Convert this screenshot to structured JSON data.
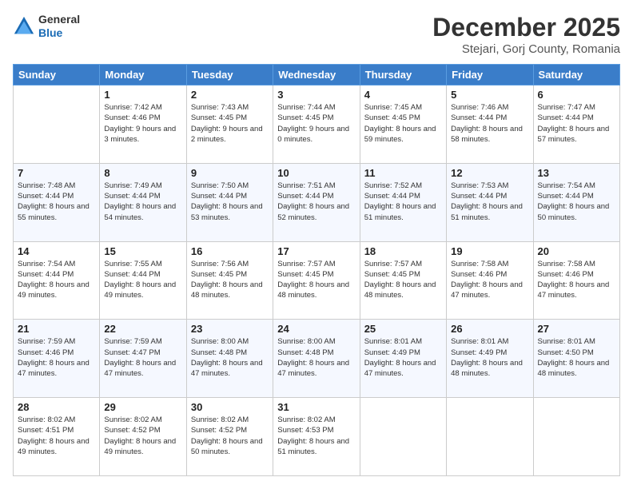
{
  "logo": {
    "general": "General",
    "blue": "Blue"
  },
  "header": {
    "month": "December 2025",
    "location": "Stejari, Gorj County, Romania"
  },
  "weekdays": [
    "Sunday",
    "Monday",
    "Tuesday",
    "Wednesday",
    "Thursday",
    "Friday",
    "Saturday"
  ],
  "weeks": [
    [
      {
        "day": "",
        "sunrise": "",
        "sunset": "",
        "daylight": ""
      },
      {
        "day": "1",
        "sunrise": "Sunrise: 7:42 AM",
        "sunset": "Sunset: 4:46 PM",
        "daylight": "Daylight: 9 hours and 3 minutes."
      },
      {
        "day": "2",
        "sunrise": "Sunrise: 7:43 AM",
        "sunset": "Sunset: 4:45 PM",
        "daylight": "Daylight: 9 hours and 2 minutes."
      },
      {
        "day": "3",
        "sunrise": "Sunrise: 7:44 AM",
        "sunset": "Sunset: 4:45 PM",
        "daylight": "Daylight: 9 hours and 0 minutes."
      },
      {
        "day": "4",
        "sunrise": "Sunrise: 7:45 AM",
        "sunset": "Sunset: 4:45 PM",
        "daylight": "Daylight: 8 hours and 59 minutes."
      },
      {
        "day": "5",
        "sunrise": "Sunrise: 7:46 AM",
        "sunset": "Sunset: 4:44 PM",
        "daylight": "Daylight: 8 hours and 58 minutes."
      },
      {
        "day": "6",
        "sunrise": "Sunrise: 7:47 AM",
        "sunset": "Sunset: 4:44 PM",
        "daylight": "Daylight: 8 hours and 57 minutes."
      }
    ],
    [
      {
        "day": "7",
        "sunrise": "Sunrise: 7:48 AM",
        "sunset": "Sunset: 4:44 PM",
        "daylight": "Daylight: 8 hours and 55 minutes."
      },
      {
        "day": "8",
        "sunrise": "Sunrise: 7:49 AM",
        "sunset": "Sunset: 4:44 PM",
        "daylight": "Daylight: 8 hours and 54 minutes."
      },
      {
        "day": "9",
        "sunrise": "Sunrise: 7:50 AM",
        "sunset": "Sunset: 4:44 PM",
        "daylight": "Daylight: 8 hours and 53 minutes."
      },
      {
        "day": "10",
        "sunrise": "Sunrise: 7:51 AM",
        "sunset": "Sunset: 4:44 PM",
        "daylight": "Daylight: 8 hours and 52 minutes."
      },
      {
        "day": "11",
        "sunrise": "Sunrise: 7:52 AM",
        "sunset": "Sunset: 4:44 PM",
        "daylight": "Daylight: 8 hours and 51 minutes."
      },
      {
        "day": "12",
        "sunrise": "Sunrise: 7:53 AM",
        "sunset": "Sunset: 4:44 PM",
        "daylight": "Daylight: 8 hours and 51 minutes."
      },
      {
        "day": "13",
        "sunrise": "Sunrise: 7:54 AM",
        "sunset": "Sunset: 4:44 PM",
        "daylight": "Daylight: 8 hours and 50 minutes."
      }
    ],
    [
      {
        "day": "14",
        "sunrise": "Sunrise: 7:54 AM",
        "sunset": "Sunset: 4:44 PM",
        "daylight": "Daylight: 8 hours and 49 minutes."
      },
      {
        "day": "15",
        "sunrise": "Sunrise: 7:55 AM",
        "sunset": "Sunset: 4:44 PM",
        "daylight": "Daylight: 8 hours and 49 minutes."
      },
      {
        "day": "16",
        "sunrise": "Sunrise: 7:56 AM",
        "sunset": "Sunset: 4:45 PM",
        "daylight": "Daylight: 8 hours and 48 minutes."
      },
      {
        "day": "17",
        "sunrise": "Sunrise: 7:57 AM",
        "sunset": "Sunset: 4:45 PM",
        "daylight": "Daylight: 8 hours and 48 minutes."
      },
      {
        "day": "18",
        "sunrise": "Sunrise: 7:57 AM",
        "sunset": "Sunset: 4:45 PM",
        "daylight": "Daylight: 8 hours and 48 minutes."
      },
      {
        "day": "19",
        "sunrise": "Sunrise: 7:58 AM",
        "sunset": "Sunset: 4:46 PM",
        "daylight": "Daylight: 8 hours and 47 minutes."
      },
      {
        "day": "20",
        "sunrise": "Sunrise: 7:58 AM",
        "sunset": "Sunset: 4:46 PM",
        "daylight": "Daylight: 8 hours and 47 minutes."
      }
    ],
    [
      {
        "day": "21",
        "sunrise": "Sunrise: 7:59 AM",
        "sunset": "Sunset: 4:46 PM",
        "daylight": "Daylight: 8 hours and 47 minutes."
      },
      {
        "day": "22",
        "sunrise": "Sunrise: 7:59 AM",
        "sunset": "Sunset: 4:47 PM",
        "daylight": "Daylight: 8 hours and 47 minutes."
      },
      {
        "day": "23",
        "sunrise": "Sunrise: 8:00 AM",
        "sunset": "Sunset: 4:48 PM",
        "daylight": "Daylight: 8 hours and 47 minutes."
      },
      {
        "day": "24",
        "sunrise": "Sunrise: 8:00 AM",
        "sunset": "Sunset: 4:48 PM",
        "daylight": "Daylight: 8 hours and 47 minutes."
      },
      {
        "day": "25",
        "sunrise": "Sunrise: 8:01 AM",
        "sunset": "Sunset: 4:49 PM",
        "daylight": "Daylight: 8 hours and 47 minutes."
      },
      {
        "day": "26",
        "sunrise": "Sunrise: 8:01 AM",
        "sunset": "Sunset: 4:49 PM",
        "daylight": "Daylight: 8 hours and 48 minutes."
      },
      {
        "day": "27",
        "sunrise": "Sunrise: 8:01 AM",
        "sunset": "Sunset: 4:50 PM",
        "daylight": "Daylight: 8 hours and 48 minutes."
      }
    ],
    [
      {
        "day": "28",
        "sunrise": "Sunrise: 8:02 AM",
        "sunset": "Sunset: 4:51 PM",
        "daylight": "Daylight: 8 hours and 49 minutes."
      },
      {
        "day": "29",
        "sunrise": "Sunrise: 8:02 AM",
        "sunset": "Sunset: 4:52 PM",
        "daylight": "Daylight: 8 hours and 49 minutes."
      },
      {
        "day": "30",
        "sunrise": "Sunrise: 8:02 AM",
        "sunset": "Sunset: 4:52 PM",
        "daylight": "Daylight: 8 hours and 50 minutes."
      },
      {
        "day": "31",
        "sunrise": "Sunrise: 8:02 AM",
        "sunset": "Sunset: 4:53 PM",
        "daylight": "Daylight: 8 hours and 51 minutes."
      },
      {
        "day": "",
        "sunrise": "",
        "sunset": "",
        "daylight": ""
      },
      {
        "day": "",
        "sunrise": "",
        "sunset": "",
        "daylight": ""
      },
      {
        "day": "",
        "sunrise": "",
        "sunset": "",
        "daylight": ""
      }
    ]
  ]
}
